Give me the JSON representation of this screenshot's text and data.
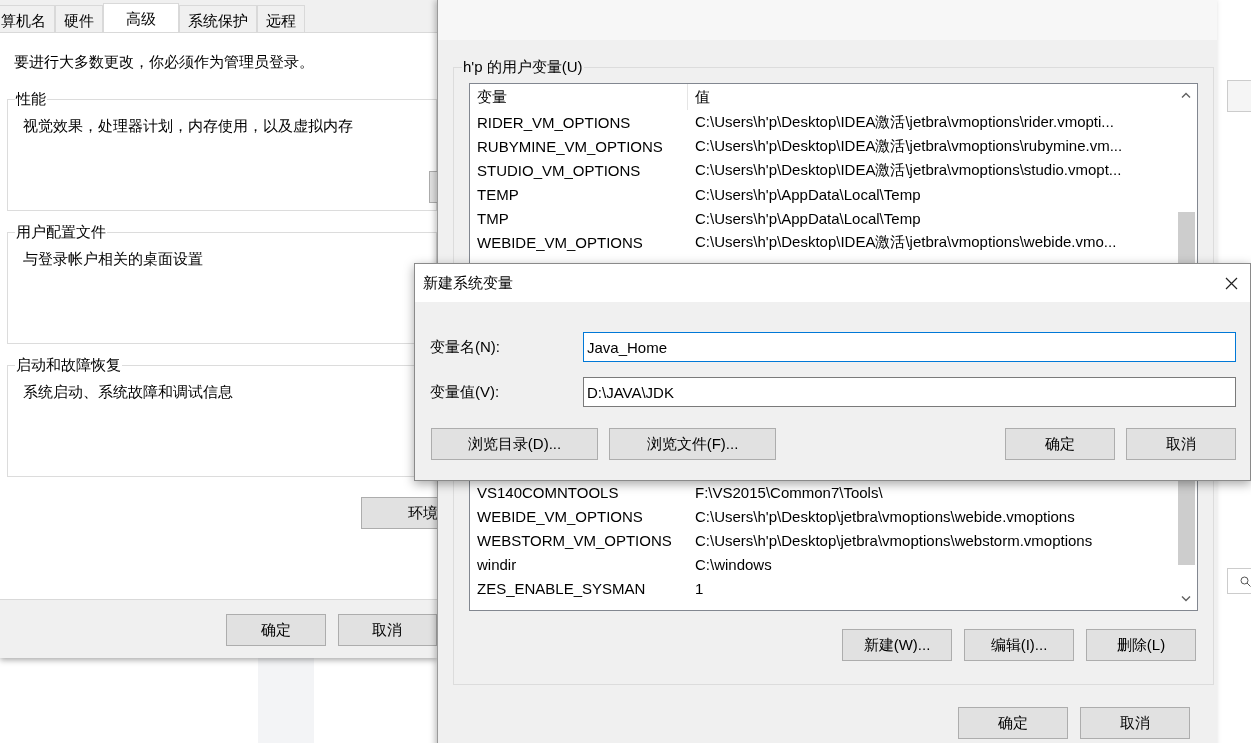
{
  "system_properties": {
    "tabs": [
      {
        "label": "算机名",
        "selected": false
      },
      {
        "label": "硬件",
        "selected": false
      },
      {
        "label": "高级",
        "selected": true
      },
      {
        "label": "系统保护",
        "selected": false
      },
      {
        "label": "远程",
        "selected": false
      }
    ],
    "admin_notice": "要进行大多数更改，你必须作为管理员登录。",
    "groups": [
      {
        "title": "性能",
        "description": "视觉效果，处理器计划，内存使用，以及虚拟内存"
      },
      {
        "title": "用户配置文件",
        "description": "与登录帐户相关的桌面设置"
      },
      {
        "title": "启动和故障恢复",
        "description": "系统启动、系统故障和调试信息"
      }
    ],
    "environment_button": "环境",
    "buttons": [
      "确定",
      "取消"
    ]
  },
  "environment_variables": {
    "user_group_title": "h'p 的用户变量(U)",
    "columns": [
      "变量",
      "值"
    ],
    "rows_top": [
      {
        "name": "RIDER_VM_OPTIONS",
        "value": "C:\\Users\\h'p\\Desktop\\IDEA激活\\jetbra\\vmoptions\\rider.vmopti..."
      },
      {
        "name": "RUBYMINE_VM_OPTIONS",
        "value": "C:\\Users\\h'p\\Desktop\\IDEA激活\\jetbra\\vmoptions\\rubymine.vm..."
      },
      {
        "name": "STUDIO_VM_OPTIONS",
        "value": "C:\\Users\\h'p\\Desktop\\IDEA激活\\jetbra\\vmoptions\\studio.vmopt..."
      },
      {
        "name": "TEMP",
        "value": "C:\\Users\\h'p\\AppData\\Local\\Temp"
      },
      {
        "name": "TMP",
        "value": "C:\\Users\\h'p\\AppData\\Local\\Temp"
      },
      {
        "name": "WEBIDE_VM_OPTIONS",
        "value": "C:\\Users\\h'p\\Desktop\\IDEA激活\\jetbra\\vmoptions\\webide.vmo..."
      }
    ],
    "rows_bottom": [
      {
        "name": "VS140COMNTOOLS",
        "value": "F:\\VS2015\\Common7\\Tools\\"
      },
      {
        "name": "WEBIDE_VM_OPTIONS",
        "value": "C:\\Users\\h'p\\Desktop\\jetbra\\vmoptions\\webide.vmoptions"
      },
      {
        "name": "WEBSTORM_VM_OPTIONS",
        "value": "C:\\Users\\h'p\\Desktop\\jetbra\\vmoptions\\webstorm.vmoptions"
      },
      {
        "name": "windir",
        "value": "C:\\windows"
      },
      {
        "name": "ZES_ENABLE_SYSMAN",
        "value": "1"
      }
    ],
    "list_buttons": [
      "新建(W)...",
      "编辑(I)...",
      "删除(L)"
    ],
    "buttons": [
      "确定",
      "取消"
    ]
  },
  "new_variable_dialog": {
    "title": "新建系统变量",
    "fields": [
      {
        "label": "变量名(N):",
        "value": "Java_Home",
        "focused": true
      },
      {
        "label": "变量值(V):",
        "value": "D:\\JAVA\\JDK",
        "focused": false
      }
    ],
    "browse_buttons": [
      "浏览目录(D)...",
      "浏览文件(F)..."
    ],
    "buttons": [
      "确定",
      "取消"
    ]
  }
}
